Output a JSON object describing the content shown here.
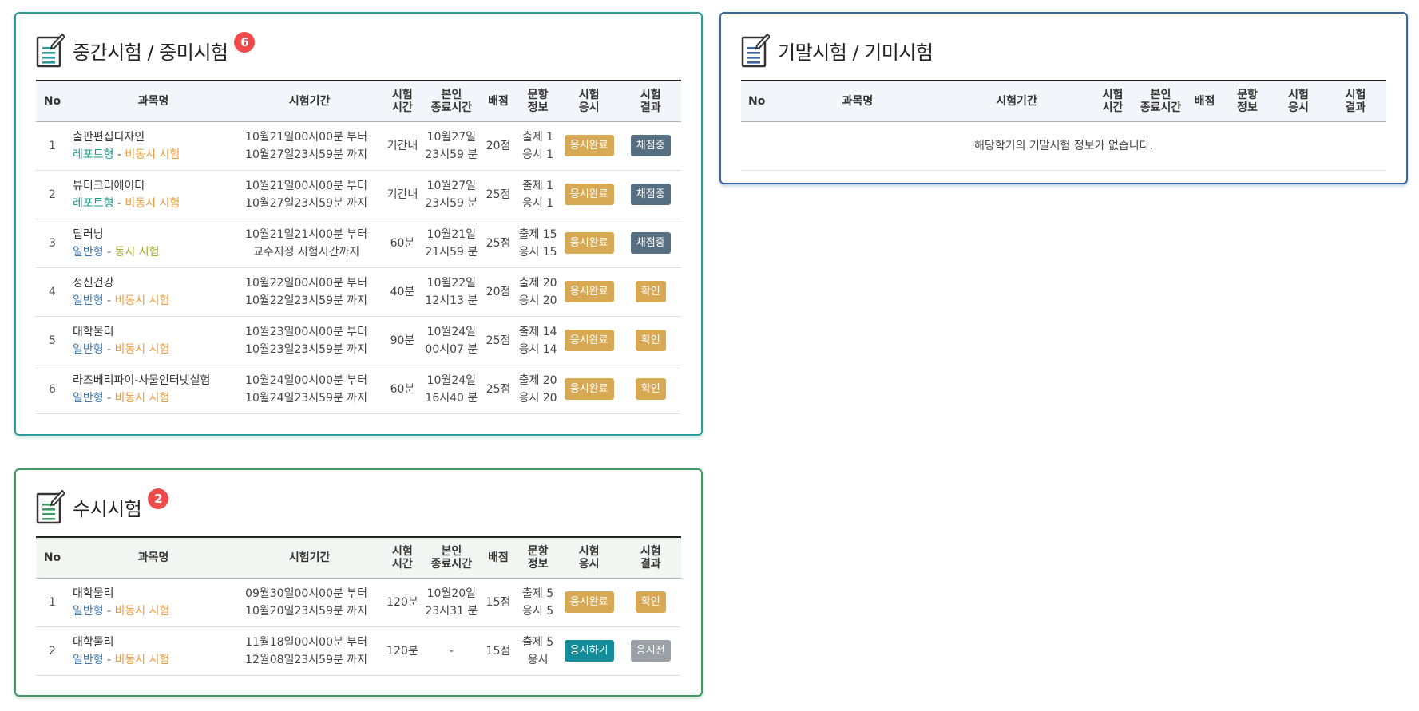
{
  "headers": [
    "No",
    "과목명",
    "시험기간",
    "시험\n시간",
    "본인\n종료시간",
    "배점",
    "문항\n정보",
    "시험\n응시",
    "시험\n결과"
  ],
  "midterm": {
    "title": "중간시험 / 중미시험",
    "badge": "6",
    "rows": [
      {
        "no": "1",
        "name": "출판편집디자인",
        "type": "레포트형",
        "mode": "비동시 시험",
        "start": "10월21일00시00분 부터",
        "end": "10월27일23시59분 까지",
        "duration": "기간내",
        "my_end_1": "10월27일",
        "my_end_2": "23시59 분",
        "score": "20점",
        "q1": "출제 1",
        "q2": "응시 1",
        "take": "응시완료",
        "result": "채점중"
      },
      {
        "no": "2",
        "name": "뷰티크리에이터",
        "type": "레포트형",
        "mode": "비동시 시험",
        "start": "10월21일00시00분 부터",
        "end": "10월27일23시59분 까지",
        "duration": "기간내",
        "my_end_1": "10월27일",
        "my_end_2": "23시59 분",
        "score": "25점",
        "q1": "출제 1",
        "q2": "응시 1",
        "take": "응시완료",
        "result": "채점중"
      },
      {
        "no": "3",
        "name": "딥러닝",
        "type": "일반형",
        "mode": "동시 시험",
        "start": "10월21일21시00분 부터",
        "end": "교수지정 시험시간까지",
        "duration": "60분",
        "my_end_1": "10월21일",
        "my_end_2": "21시59 분",
        "score": "25점",
        "q1": "출제 15",
        "q2": "응시 15",
        "take": "응시완료",
        "result": "채점중"
      },
      {
        "no": "4",
        "name": "정신건강",
        "type": "일반형",
        "mode": "비동시 시험",
        "start": "10월22일00시00분 부터",
        "end": "10월22일23시59분 까지",
        "duration": "40분",
        "my_end_1": "10월22일",
        "my_end_2": "12시13 분",
        "score": "20점",
        "q1": "출제 20",
        "q2": "응시 20",
        "take": "응시완료",
        "result": "확인"
      },
      {
        "no": "5",
        "name": "대학물리",
        "type": "일반형",
        "mode": "비동시 시험",
        "start": "10월23일00시00분 부터",
        "end": "10월23일23시59분 까지",
        "duration": "90분",
        "my_end_1": "10월24일",
        "my_end_2": "00시07 분",
        "score": "25점",
        "q1": "출제 14",
        "q2": "응시 14",
        "take": "응시완료",
        "result": "확인"
      },
      {
        "no": "6",
        "name": "라즈베리파이-사물인터넷실험",
        "type": "일반형",
        "mode": "비동시 시험",
        "start": "10월24일00시00분 부터",
        "end": "10월24일23시59분 까지",
        "duration": "60분",
        "my_end_1": "10월24일",
        "my_end_2": "16시40 분",
        "score": "25점",
        "q1": "출제 20",
        "q2": "응시 20",
        "take": "응시완료",
        "result": "확인"
      }
    ]
  },
  "final": {
    "title": "기말시험 / 기미시험",
    "empty_message": "해당학기의 기말시험 정보가 없습니다."
  },
  "quiz": {
    "title": "수시시험",
    "badge": "2",
    "rows": [
      {
        "no": "1",
        "name": "대학물리",
        "type": "일반형",
        "mode": "비동시 시험",
        "start": "09월30일00시00분 부터",
        "end": "10월20일23시59분 까지",
        "duration": "120분",
        "my_end_1": "10월20일",
        "my_end_2": "23시31 분",
        "score": "15점",
        "q1": "출제 5",
        "q2": "응시 5",
        "take": "응시완료",
        "result": "확인"
      },
      {
        "no": "2",
        "name": "대학물리",
        "type": "일반형",
        "mode": "비동시 시험",
        "start": "11월18일00시00분 부터",
        "end": "12월08일23시59분 까지",
        "duration": "120분",
        "my_end_1": "-",
        "my_end_2": "",
        "score": "15점",
        "q1": "출제 5",
        "q2": "응시",
        "take": "응시하기",
        "result": "응시전"
      }
    ]
  },
  "colors": {
    "midterm_border": "#2a9d9a",
    "final_border": "#3a67a8",
    "quiz_border": "#3f9b63",
    "badge": "#ef4b4b",
    "btn_done": "#d8a955",
    "btn_grading": "#566e82",
    "btn_take": "#138d9a",
    "btn_before": "#9aa0a6"
  }
}
